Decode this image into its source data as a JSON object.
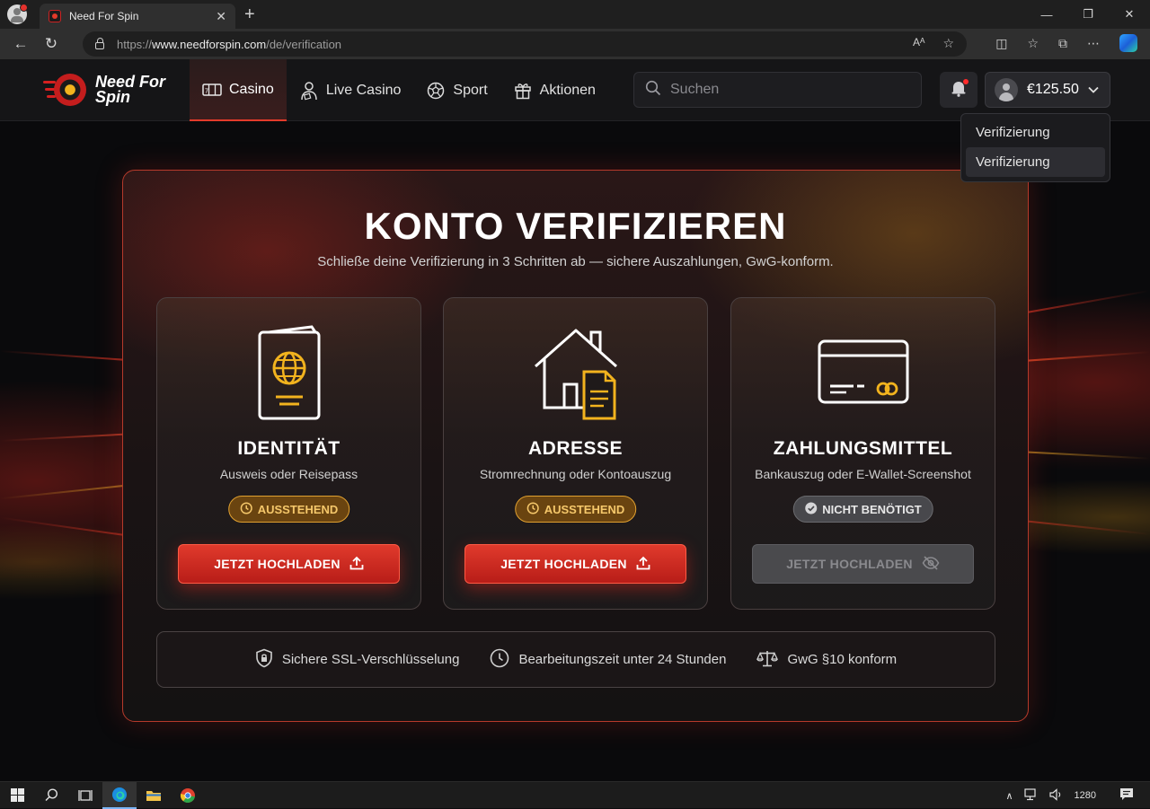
{
  "browser": {
    "tab_title": "Need For Spin",
    "url_proto": "https://",
    "url_host": "www.needforspin.com",
    "url_path": "/de/verification"
  },
  "site": {
    "logo_line1": "Need For",
    "logo_line2": "Spin",
    "nav": [
      {
        "label": "Casino",
        "icon": "slot-machine-icon",
        "active": true
      },
      {
        "label": "Live Casino",
        "icon": "dealer-icon",
        "active": false
      },
      {
        "label": "Sport",
        "icon": "soccer-ball-icon",
        "active": false
      },
      {
        "label": "Aktionen",
        "icon": "gift-icon",
        "active": false
      }
    ],
    "search_placeholder": "Suchen",
    "balance": "€125.50",
    "dropdown": [
      "Verifizierung",
      "Verifizierung"
    ]
  },
  "verification": {
    "title": "KONTO VERIFIZIEREN",
    "subtitle": "Schließe deine Verifizierung in 3 Schritten ab — sichere Auszahlungen, GwG-konform.",
    "cards": [
      {
        "title": "IDENTITÄT",
        "subtitle": "Ausweis oder Reisepass",
        "status": "AUSSTEHEND",
        "button": "JETZT HOCHLADEN",
        "icon": "passport-icon"
      },
      {
        "title": "ADRESSE",
        "subtitle": "Stromrechnung oder Kontoauszug",
        "status": "AUSSTEHEND",
        "button": "JETZT HOCHLADEN",
        "icon": "house-document-icon"
      },
      {
        "title": "ZAHLUNGSMITTEL",
        "subtitle": "Bankauszug oder E-Wallet-Screenshot",
        "status": "NICHT BENÖTIGT",
        "button": "JETZT HOCHLADEN",
        "icon": "credit-card-icon"
      }
    ],
    "info": [
      "Sichere SSL-Verschlüsselung",
      "Bearbeitungszeit unter 24 Stunden",
      "GwG §10 konform"
    ]
  },
  "taskbar": {
    "clock": "1280"
  },
  "colors": {
    "accent_red": "#e03a2c",
    "pending_amber": "#e0a030",
    "icon_gold": "#f2b31e"
  }
}
